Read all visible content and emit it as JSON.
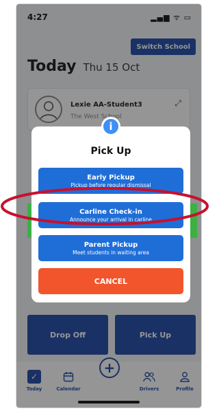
{
  "status_bar": {
    "time": "4:27",
    "icons": "▂▄▆ ᯤ ▭"
  },
  "header": {
    "switch_school": "Switch School",
    "title": "Today",
    "date": "Thu 15 Oct"
  },
  "student_card": {
    "name": "Lexie AA-Student3",
    "school": "The West School"
  },
  "actions": {
    "drop_off": "Drop Off",
    "pick_up": "Pick Up"
  },
  "tabs": [
    {
      "label": "Today",
      "icon": "check-icon"
    },
    {
      "label": "Calendar",
      "icon": "calendar-icon"
    },
    {
      "label": "",
      "icon": "plus-icon"
    },
    {
      "label": "Drivers",
      "icon": "drivers-icon"
    },
    {
      "label": "Profile",
      "icon": "profile-icon"
    }
  ],
  "modal": {
    "title": "Pick Up",
    "options": [
      {
        "title": "Early Pickup",
        "subtitle": "Pickup before regular dismissal"
      },
      {
        "title": "Carline Check-in",
        "subtitle": "Announce your arrival in carline"
      },
      {
        "title": "Parent Pickup",
        "subtitle": "Meet students in waiting area"
      }
    ],
    "cancel": "CANCEL"
  },
  "colors": {
    "primary": "#1f4aa8",
    "option_blue": "#1f6ed8",
    "cancel": "#f2552c",
    "highlight": "#c8102e",
    "info": "#3f8ff5"
  }
}
